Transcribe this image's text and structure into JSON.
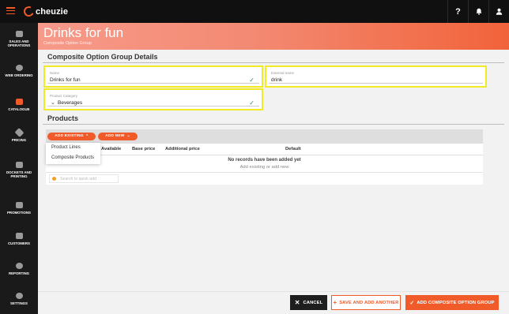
{
  "brand": {
    "logo_text": "cheuzie",
    "accent": "#f15a29"
  },
  "topbar": {
    "help_label": "?",
    "bell_icon": "bell-icon",
    "user_icon": "user-icon"
  },
  "sidebar": {
    "items": [
      {
        "label": "SALES AND OPERATIONS",
        "icon": "chart-icon"
      },
      {
        "label": "WEB ORDERING",
        "icon": "globe-icon"
      },
      {
        "label": "CATALOGUE",
        "icon": "book-icon",
        "active": true
      },
      {
        "label": "PRICING",
        "icon": "tag-icon"
      },
      {
        "label": "DOCKETS AND PRINTING",
        "icon": "printer-icon"
      },
      {
        "label": "PROMOTIONS",
        "icon": "megaphone-icon"
      },
      {
        "label": "CUSTOMERS",
        "icon": "people-icon"
      },
      {
        "label": "REPORTING",
        "icon": "pie-icon"
      },
      {
        "label": "SETTINGS",
        "icon": "gear-icon"
      }
    ]
  },
  "header": {
    "title": "Drinks for fun",
    "subtitle": "Composite Option Group"
  },
  "details": {
    "title": "Composite Option Group Details",
    "name": {
      "label": "Name",
      "value": "Drinks for fun"
    },
    "external_name": {
      "label": "External name",
      "value": "drink"
    },
    "product_category": {
      "label": "Product Category",
      "value": "Beverages"
    }
  },
  "products": {
    "title": "Products",
    "add_existing_label": "ADD EXISTING",
    "add_new_label": "ADD NEW",
    "dropdown": [
      "Product Lines",
      "Composite Products"
    ],
    "columns": {
      "available": "Available",
      "base_price": "Base price",
      "additional_price": "Additional price",
      "default": "Default"
    },
    "empty_title": "No records have been added yet",
    "empty_hint": "Add existing or add new",
    "search_placeholder": "Search to quick add"
  },
  "footer": {
    "cancel_label": "CANCEL",
    "save_add_another_label": "SAVE AND ADD ANOTHER",
    "add_label": "ADD COMPOSITE OPTION GROUP"
  }
}
